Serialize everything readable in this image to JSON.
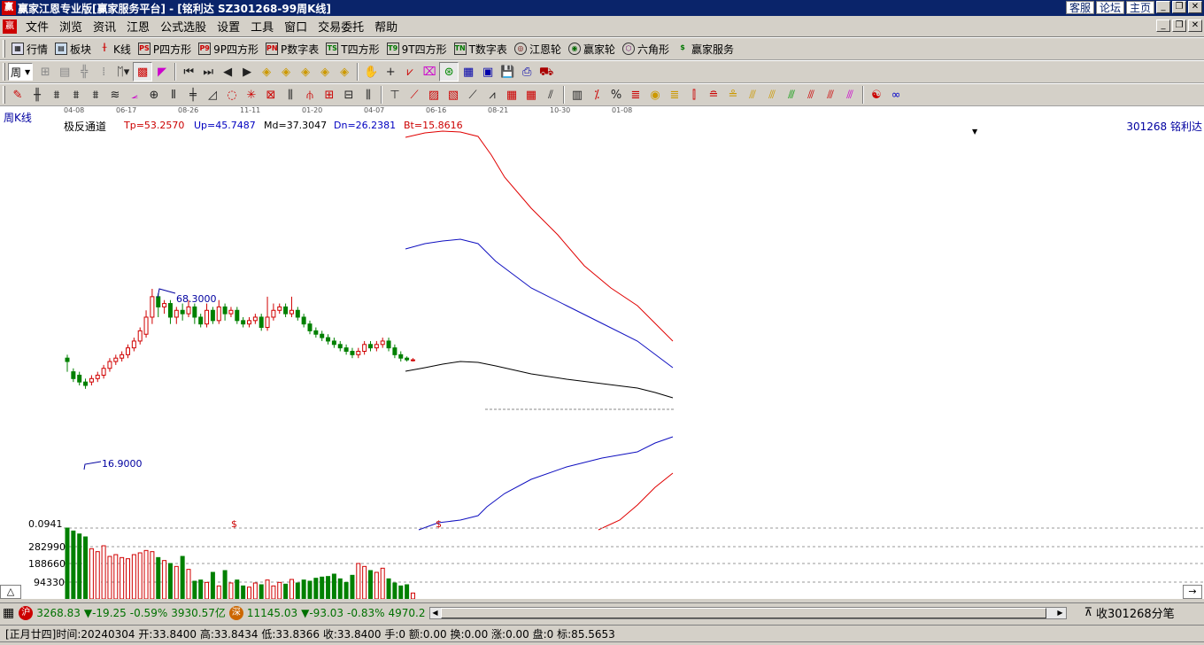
{
  "window": {
    "title": "赢家江恩专业版[赢家服务平台] - [铭利达  SZ301268-99周K线]",
    "links": [
      "客服",
      "论坛",
      "主页"
    ]
  },
  "menu": [
    "文件",
    "浏览",
    "资讯",
    "江恩",
    "公式选股",
    "设置",
    "工具",
    "窗口",
    "交易委托",
    "帮助"
  ],
  "toolbar1": [
    {
      "icon": "grid-icon",
      "label": "行情"
    },
    {
      "icon": "blocks-icon",
      "label": "板块"
    },
    {
      "icon": "candlestick-icon",
      "label": "K线"
    },
    {
      "icon": "square-p-icon",
      "label": "P四方形",
      "badge": "PS"
    },
    {
      "icon": "square-9p-icon",
      "label": "9P四方形",
      "badge": "P9"
    },
    {
      "icon": "number-table-p-icon",
      "label": "P数字表",
      "badge": "PN"
    },
    {
      "icon": "square-t-icon",
      "label": "T四方形",
      "badge": "TS"
    },
    {
      "icon": "square-9t-icon",
      "label": "9T四方形",
      "badge": "T9"
    },
    {
      "icon": "number-table-t-icon",
      "label": "T数字表",
      "badge": "TN"
    },
    {
      "icon": "gann-wheel-icon",
      "label": "江恩轮"
    },
    {
      "icon": "winner-wheel-icon",
      "label": "赢家轮"
    },
    {
      "icon": "hexagon-icon",
      "label": "六角形"
    },
    {
      "icon": "dollar-icon",
      "label": "赢家服务"
    }
  ],
  "period": {
    "value": "周"
  },
  "chart": {
    "period_label": "周K线",
    "indicator_name": "极反通道",
    "params": [
      {
        "key": "tp",
        "text": "Tp=53.2570"
      },
      {
        "key": "up",
        "text": "Up=45.7487"
      },
      {
        "key": "md",
        "text": "Md=37.3047"
      },
      {
        "key": "dn",
        "text": "Dn=26.2381"
      },
      {
        "key": "bt",
        "text": "Bt=15.8616"
      }
    ],
    "stock_label": "301268 铭利达",
    "high_label": "68.3000",
    "low_label": "16.9000",
    "date_ticks": [
      "04-08",
      "06-17",
      "08-26",
      "11-11",
      "01-20",
      "04-07",
      "06-16",
      "08-21",
      "10-30",
      "01-08"
    ],
    "volume_axis": [
      "0.0941",
      "282990",
      "188660",
      "94330"
    ],
    "dollar_marks": [
      "$",
      "$"
    ],
    "colors": {
      "up": "#d00000",
      "down": "#008000",
      "red_line": "#e00000",
      "blue_line": "#1010c0",
      "black_line": "#000000"
    }
  },
  "chart_data": {
    "type": "candlestick",
    "y_range": [
      16.9,
      68.3
    ],
    "candles": [
      [
        48,
        47,
        49,
        44
      ],
      [
        44,
        42,
        45,
        41
      ],
      [
        43,
        41,
        44,
        40
      ],
      [
        41,
        40,
        42,
        39
      ],
      [
        41,
        42,
        43,
        40
      ],
      [
        42,
        43,
        44,
        41
      ],
      [
        43,
        45,
        46,
        42
      ],
      [
        45,
        47,
        48,
        44
      ],
      [
        47,
        48,
        49,
        46
      ],
      [
        48,
        49,
        50,
        47
      ],
      [
        49,
        51,
        52,
        48
      ],
      [
        51,
        53,
        54,
        50
      ],
      [
        53,
        56,
        57,
        52
      ],
      [
        55,
        60,
        62,
        54
      ],
      [
        60,
        66,
        68.3,
        58
      ],
      [
        66,
        63,
        67,
        60
      ],
      [
        63,
        64,
        65,
        61
      ],
      [
        64,
        60,
        65,
        58
      ],
      [
        60,
        62,
        63,
        58
      ],
      [
        62,
        61,
        64,
        59
      ],
      [
        61,
        63,
        65,
        60
      ],
      [
        63,
        60,
        64,
        58
      ],
      [
        60,
        58,
        61,
        57
      ],
      [
        58,
        62,
        64,
        57
      ],
      [
        62,
        59,
        63,
        58
      ],
      [
        59,
        63,
        65,
        58
      ],
      [
        63,
        61,
        64,
        59
      ],
      [
        61,
        62,
        63,
        60
      ],
      [
        62,
        59,
        63,
        58
      ],
      [
        59,
        58,
        60,
        57
      ],
      [
        58,
        59,
        60,
        57
      ],
      [
        59,
        60,
        61,
        58
      ],
      [
        60,
        57,
        61,
        56
      ],
      [
        57,
        60,
        66,
        56
      ],
      [
        60,
        62,
        64,
        59
      ],
      [
        62,
        63,
        64,
        61
      ],
      [
        63,
        61,
        64,
        60
      ],
      [
        61,
        62,
        66,
        60
      ],
      [
        62,
        60,
        63,
        59
      ],
      [
        60,
        58,
        61,
        57
      ],
      [
        58,
        56,
        59,
        55
      ],
      [
        56,
        55,
        57,
        54
      ],
      [
        55,
        54,
        56,
        53
      ],
      [
        54,
        53,
        55,
        52
      ],
      [
        53,
        52,
        54,
        51
      ],
      [
        52,
        51,
        53,
        50
      ],
      [
        51,
        50,
        52,
        49
      ],
      [
        50,
        49,
        51,
        48
      ],
      [
        49,
        50,
        51,
        48
      ],
      [
        50,
        52,
        53,
        49
      ],
      [
        52,
        51,
        53,
        50
      ],
      [
        51,
        52,
        53,
        50
      ],
      [
        52,
        53,
        54,
        51
      ],
      [
        53,
        51,
        54,
        50
      ],
      [
        51,
        49,
        52,
        48
      ],
      [
        49,
        48,
        50,
        47
      ],
      [
        48,
        47.5,
        48.5,
        47
      ],
      [
        47.5,
        47.5,
        48,
        47
      ]
    ],
    "volume": [
      120,
      115,
      110,
      105,
      85,
      80,
      90,
      72,
      75,
      70,
      68,
      75,
      78,
      82,
      80,
      70,
      65,
      60,
      55,
      72,
      50,
      30,
      32,
      28,
      45,
      22,
      48,
      27,
      32,
      22,
      20,
      27,
      24,
      32,
      22,
      28,
      25,
      33,
      27,
      32,
      30,
      35,
      37,
      38,
      42,
      34,
      28,
      40,
      60,
      55,
      48,
      45,
      52,
      34,
      27,
      22,
      24,
      10
    ]
  },
  "volume_label": "",
  "status": {
    "sh_label": "沪",
    "sh_index": "3268.83",
    "sh_change": "▼-19.25",
    "sh_pct": "-0.59%",
    "sh_amount": "3930.57亿",
    "sz_label": "深",
    "sz_index": "11145.03",
    "sz_change": "▼-93.03",
    "sz_pct": "-0.83%",
    "sz_amount": "4970.2",
    "right_text": "收301268分笔"
  },
  "info": {
    "lunar": "[正月廿四]",
    "time": "时间:20240304",
    "open": "开:33.8400",
    "high": "高:33.8434",
    "low": "低:33.8366",
    "close": "收:33.8400",
    "hand": "手:0",
    "amount": "额:0.00",
    "turnover": "换:0.00",
    "rise": "涨:0.00",
    "pan": "盘:0",
    "mark": "标:85.5653"
  }
}
